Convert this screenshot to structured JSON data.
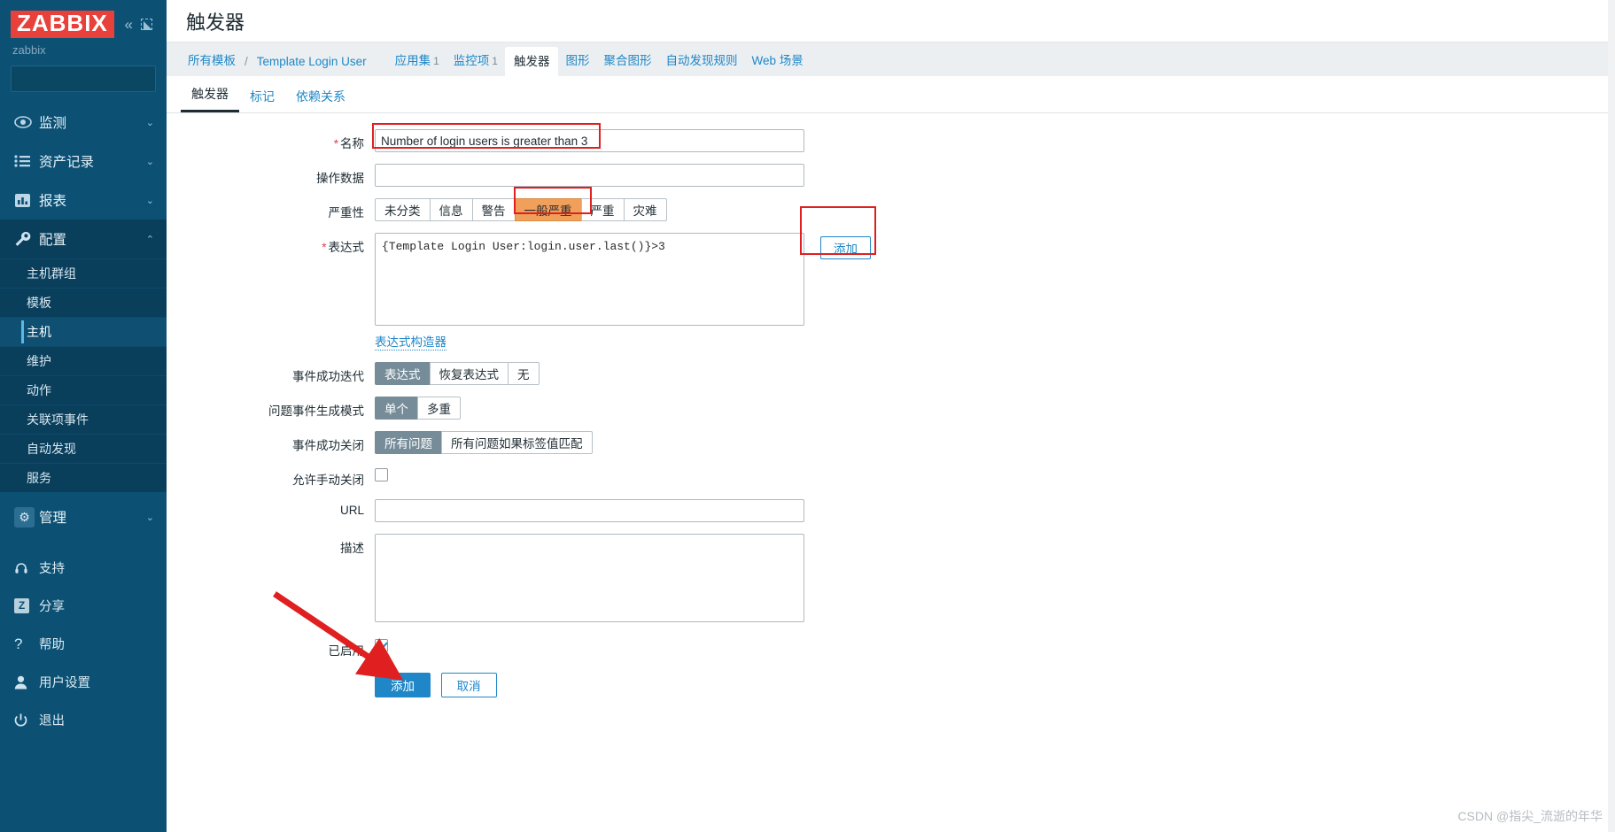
{
  "sidebar": {
    "logo_text": "ZABBIX",
    "server_name": "zabbix",
    "collapse_icon": "chevron-double-left-icon",
    "expand_icon": "expand-icon",
    "search": {
      "value": "",
      "placeholder": "",
      "icon": "search-icon"
    },
    "nav": [
      {
        "label": "监测",
        "icon": "eye-icon",
        "caret": "⌄",
        "open": false
      },
      {
        "label": "资产记录",
        "icon": "list-icon",
        "caret": "⌄",
        "open": false
      },
      {
        "label": "报表",
        "icon": "bar-chart-icon",
        "caret": "⌄",
        "open": false
      },
      {
        "label": "配置",
        "icon": "wrench-icon",
        "caret": "⌃",
        "open": true
      }
    ],
    "submenu": [
      {
        "label": "主机群组",
        "active": false
      },
      {
        "label": "模板",
        "active": false
      },
      {
        "label": "主机",
        "active": true
      },
      {
        "label": "维护",
        "active": false
      },
      {
        "label": "动作",
        "active": false
      },
      {
        "label": "关联项事件",
        "active": false
      },
      {
        "label": "自动发现",
        "active": false
      },
      {
        "label": "服务",
        "active": false
      }
    ],
    "admin": {
      "label": "管理",
      "icon": "gear-icon",
      "caret": "⌄"
    },
    "bottom": [
      {
        "label": "支持",
        "icon": "headset-icon"
      },
      {
        "label": "分享",
        "icon": "zabbix-z-icon"
      },
      {
        "label": "帮助",
        "icon": "question-icon"
      },
      {
        "label": "用户设置",
        "icon": "user-icon"
      },
      {
        "label": "退出",
        "icon": "power-icon"
      }
    ]
  },
  "header": {
    "title": "触发器"
  },
  "breadcrumb": [
    {
      "label": "所有模板",
      "type": "link"
    },
    {
      "label": "/",
      "type": "sep"
    },
    {
      "label": "Template Login User",
      "type": "link"
    }
  ],
  "crumb_tabs": [
    {
      "label": "应用集",
      "count": "1",
      "active": false
    },
    {
      "label": "监控项",
      "count": "1",
      "active": false
    },
    {
      "label": "触发器",
      "count": "",
      "active": true
    },
    {
      "label": "图形",
      "count": "",
      "active": false
    },
    {
      "label": "聚合图形",
      "count": "",
      "active": false
    },
    {
      "label": "自动发现规则",
      "count": "",
      "active": false
    },
    {
      "label": "Web 场景",
      "count": "",
      "active": false
    }
  ],
  "subtabs": [
    {
      "label": "触发器",
      "active": true
    },
    {
      "label": "标记",
      "active": false
    },
    {
      "label": "依赖关系",
      "active": false
    }
  ],
  "form": {
    "name": {
      "label": "名称",
      "required": true,
      "value": "Number of login users is greater than 3",
      "placeholder": ""
    },
    "opdata": {
      "label": "操作数据",
      "required": false,
      "value": "",
      "placeholder": ""
    },
    "severity": {
      "label": "严重性",
      "options": [
        "未分类",
        "信息",
        "警告",
        "一般严重",
        "严重",
        "灾难"
      ],
      "selected": "一般严重",
      "selected_color": "#f0a05a"
    },
    "expression": {
      "label": "表达式",
      "required": true,
      "value": "{Template Login User:login.user.last()}>3",
      "add_button": "添加",
      "constructor_link": "表达式构造器"
    },
    "ok_event_generation": {
      "label": "事件成功迭代",
      "options": [
        "表达式",
        "恢复表达式",
        "无"
      ],
      "selected": "表达式"
    },
    "problem_event_mode": {
      "label": "问题事件生成模式",
      "options": [
        "单个",
        "多重"
      ],
      "selected": "单个"
    },
    "ok_event_closes": {
      "label": "事件成功关闭",
      "options": [
        "所有问题",
        "所有问题如果标签值匹配"
      ],
      "selected": "所有问题"
    },
    "manual_close": {
      "label": "允许手动关闭",
      "checked": false
    },
    "url": {
      "label": "URL",
      "value": "",
      "placeholder": ""
    },
    "description": {
      "label": "描述",
      "value": "",
      "placeholder": ""
    },
    "enabled": {
      "label": "已启用",
      "checked": true
    },
    "submit": "添加",
    "cancel": "取消"
  },
  "watermark": "CSDN @指尖_流逝的年华"
}
